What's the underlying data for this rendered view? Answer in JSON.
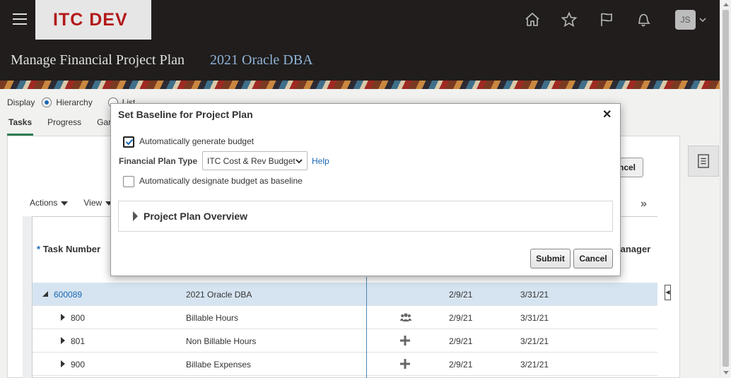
{
  "header": {
    "logo_text": "ITC DEV",
    "user_initials": "JS",
    "icons": [
      "home-icon",
      "favorites-star-icon",
      "watchlist-flag-icon",
      "notifications-bell-icon"
    ]
  },
  "page": {
    "title": "Manage Financial Project Plan",
    "subtitle": "2021 Oracle DBA"
  },
  "display": {
    "label": "Display",
    "options": [
      "Hierarchy",
      "List"
    ],
    "selected": "Hierarchy"
  },
  "tabs": [
    "Tasks",
    "Progress",
    "Gar"
  ],
  "toolbar": {
    "actions_label": "Actions",
    "view_label": "View",
    "cancel_partial": "ncel"
  },
  "table": {
    "col_task_number": "Task Number",
    "col_required_marker": "*",
    "col_manager_partial": "lanager",
    "rows": [
      {
        "number": "600089",
        "name": "2021 Oracle DBA",
        "start": "2/9/21",
        "finish": "3/31/21",
        "expanded": true,
        "icon": ""
      },
      {
        "number": "800",
        "name": "Billable Hours",
        "start": "2/9/21",
        "finish": "3/31/21",
        "expanded": false,
        "icon": "people-icon"
      },
      {
        "number": "801",
        "name": "Non Billable Hours",
        "start": "2/9/21",
        "finish": "3/21/21",
        "expanded": false,
        "icon": "plus-icon"
      },
      {
        "number": "900",
        "name": "Billabe Expenses",
        "start": "2/9/21",
        "finish": "3/21/21",
        "expanded": false,
        "icon": "plus-icon"
      }
    ]
  },
  "dialog": {
    "title": "Set Baseline for Project Plan",
    "auto_generate_label": "Automatically generate budget",
    "auto_generate_checked": true,
    "financial_plan_type_label": "Financial Plan Type",
    "financial_plan_type_value": "ITC Cost & Rev Budget",
    "help_label": "Help",
    "auto_designate_label": "Automatically designate budget as baseline",
    "auto_designate_checked": false,
    "overview_label": "Project Plan Overview",
    "submit_label": "Submit",
    "cancel_label": "Cancel"
  },
  "colors": {
    "header_bg": "#201d1c",
    "logo_red": "#b3191b",
    "link_blue": "#1a68b3",
    "selected_row": "#d6e4f1"
  }
}
